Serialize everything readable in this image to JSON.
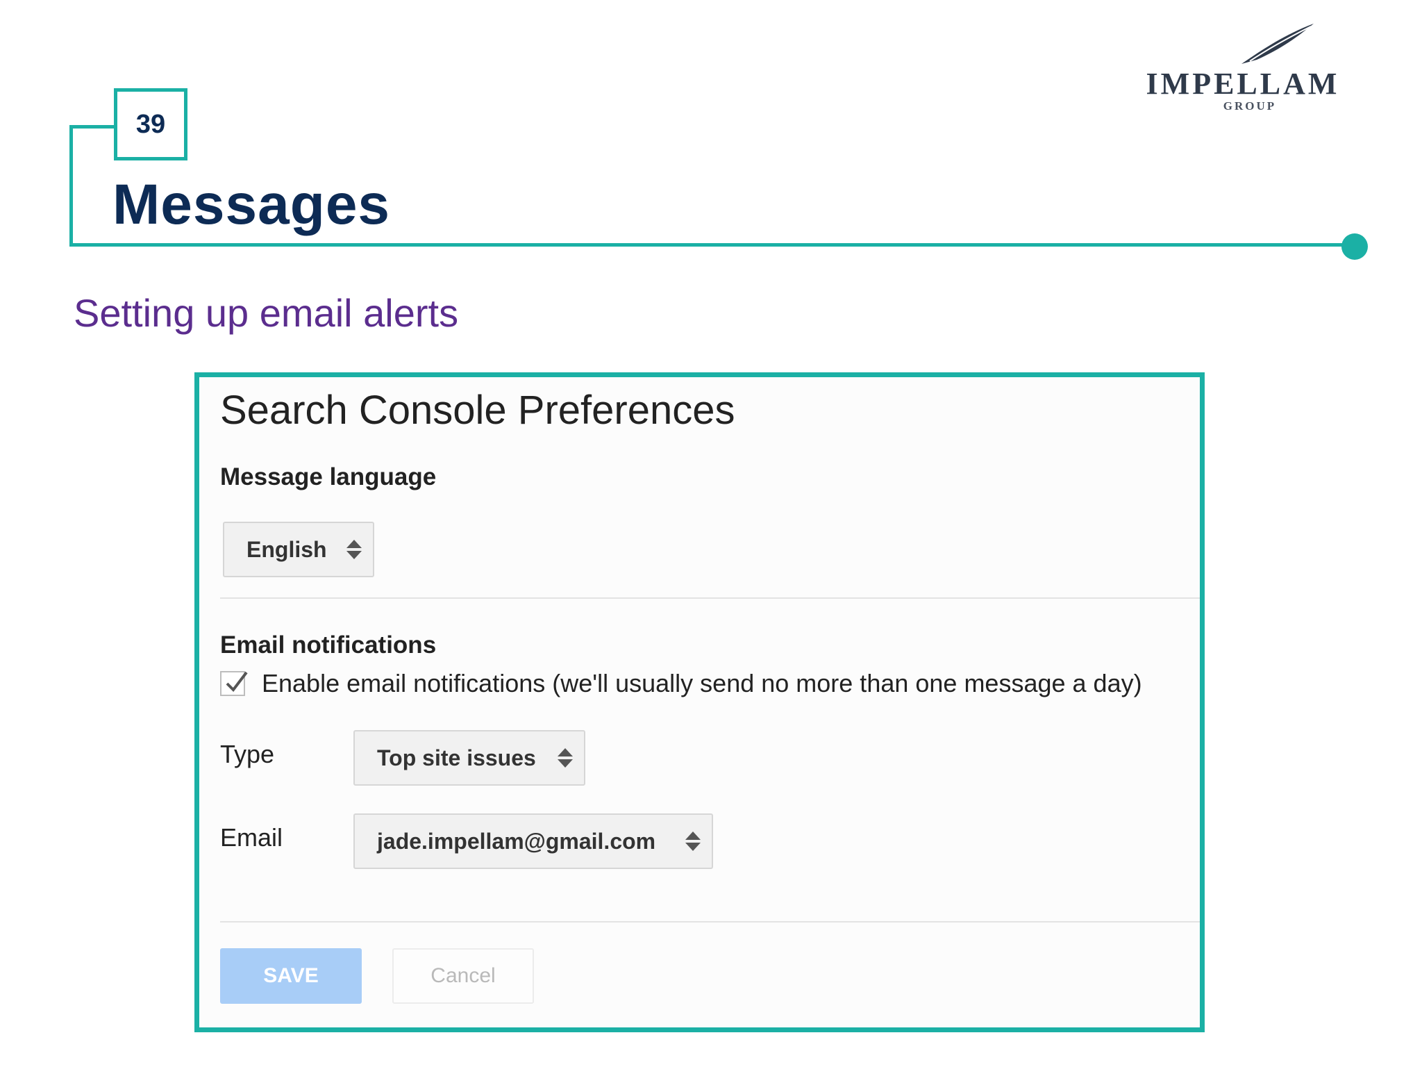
{
  "slide": {
    "page_number": "39",
    "title": "Messages",
    "subtitle": "Setting up email alerts",
    "accent_color": "#1bb0a5",
    "title_color": "#0d2b55",
    "subtitle_color": "#5b2d8e"
  },
  "logo": {
    "name": "IMPELLAM",
    "sub": "GROUP",
    "icon": "feather-quill-icon"
  },
  "preferences": {
    "title": "Search Console Preferences",
    "message_language": {
      "label": "Message language",
      "selected": "English"
    },
    "email_notifications": {
      "label": "Email notifications",
      "enable_checked": true,
      "enable_label": "Enable email notifications (we'll usually send no more than one message a day)",
      "type_label": "Type",
      "type_selected": "Top site issues",
      "email_label": "Email",
      "email_selected": "jade.impellam@gmail.com"
    },
    "save_label": "SAVE",
    "cancel_label": "Cancel"
  }
}
